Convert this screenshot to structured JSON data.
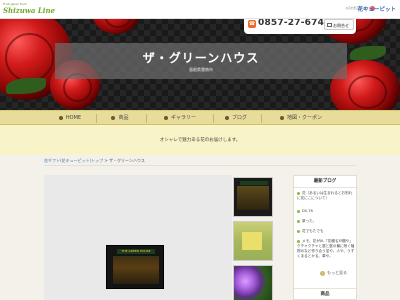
{
  "header": {
    "logo_left_tagline": "Fruit Japan from",
    "logo_left_name": "Shizuwa Line",
    "logo_right_tagline": "お花を贈る想いを大切に",
    "logo_right_brand": "花キューピット"
  },
  "hero": {
    "title": "ザ・グリーンハウス",
    "subtitle": "島根県雲南市",
    "phone": "0857-27-6748",
    "phone_icon": "phone-icon",
    "mail_label": "お問合せ",
    "mail_icon": "mail-icon"
  },
  "nav": {
    "items": [
      {
        "label": "HOME",
        "icon": "home-icon"
      },
      {
        "label": "商品",
        "icon": "gift-icon"
      },
      {
        "label": "ギャラリー",
        "icon": "gallery-icon"
      },
      {
        "label": "ブログ",
        "icon": "pen-icon"
      },
      {
        "label": "地図・クーポン",
        "icon": "map-icon"
      }
    ]
  },
  "tagline": "オシャレで魅力ある花のお届けします。",
  "breadcrumb": {
    "link": "花ギフト(花キューピット)トップ",
    "sep": " > ",
    "current": "ザ・グリーンハウス"
  },
  "gallery": {
    "main_sign": "THE GREEN HOUSE"
  },
  "sidebar": {
    "blog_heading": "最新ブログ",
    "posts": [
      "花（あるいは生まれるとお別れに花にこについて）",
      "DS.78",
      "祭った。",
      "花でもたでも",
      "メモ、花がJIL「花綴る戸棚や」クチャクチャと庭と庭の最に咲く植物のなど作り合う並や、人や、うずくまるとかる、車や。"
    ],
    "more_label": "もっと見る",
    "products_heading": "商品"
  }
}
